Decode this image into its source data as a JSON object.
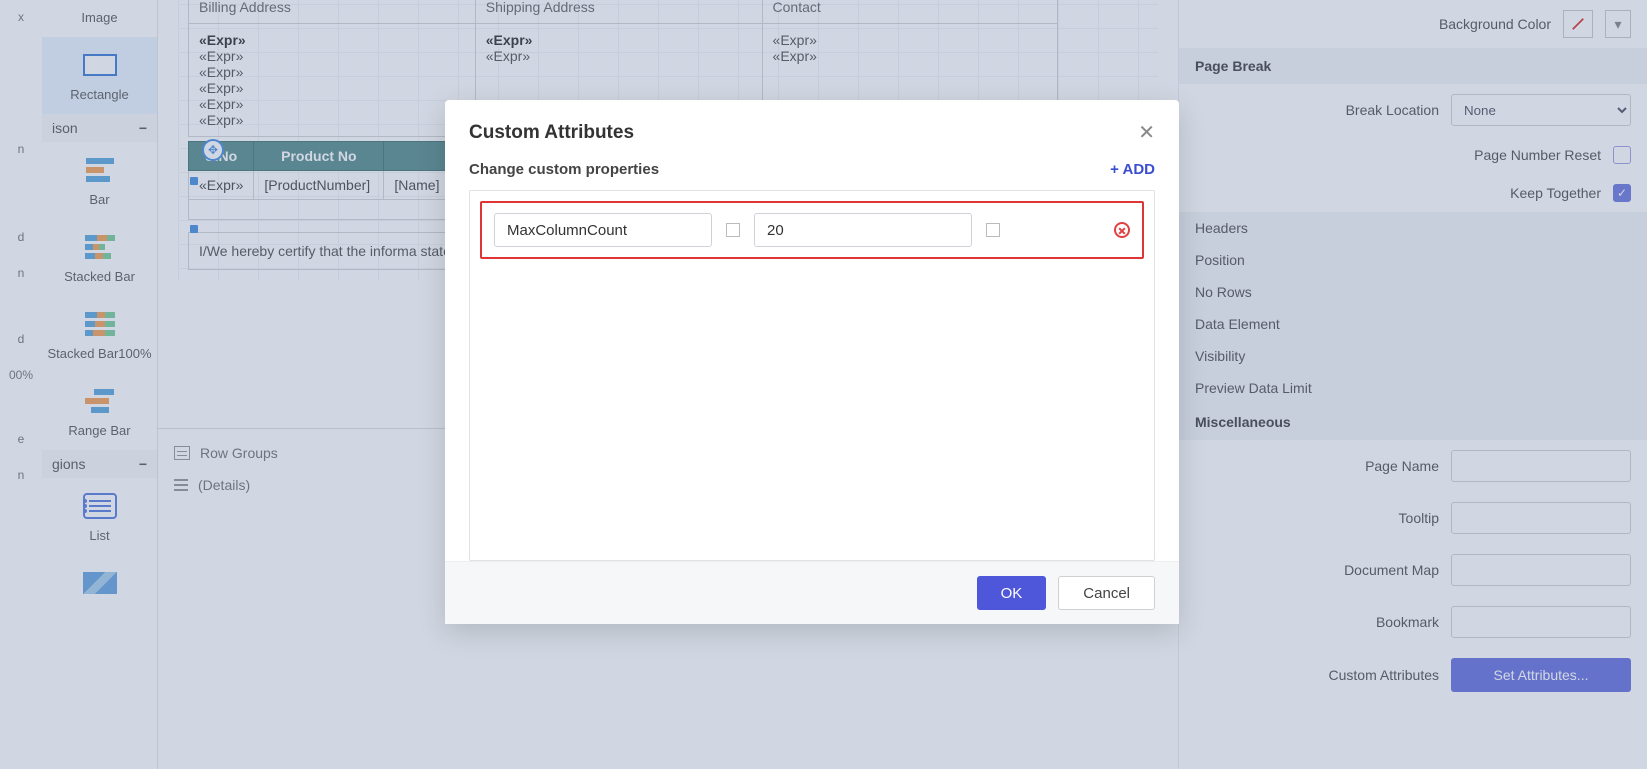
{
  "toolbox": {
    "items_top": [
      {
        "label": "Image"
      },
      {
        "label": "Rectangle",
        "selected": true
      }
    ],
    "section_comparison": "ison",
    "items_bar": [
      {
        "label": "Bar"
      },
      {
        "label": "Stacked Bar"
      },
      {
        "label": "Stacked Bar100%"
      },
      {
        "label": "Range Bar"
      }
    ],
    "section_regions": "gions",
    "items_region": [
      {
        "label": "List"
      }
    ],
    "narrow": [
      {
        "label": "x"
      },
      {
        "label": "n"
      },
      {
        "label": "d"
      },
      {
        "label": "n"
      },
      {
        "label": "d"
      },
      {
        "label": "00%"
      },
      {
        "label": "e"
      },
      {
        "label": "n"
      }
    ]
  },
  "report": {
    "headers": {
      "billing": "Billing Address",
      "shipping": "Shipping Address",
      "contact": "Contact"
    },
    "billing_rows": [
      "«Expr»",
      "«Expr»",
      "«Expr»",
      "«Expr»",
      "«Expr»",
      "«Expr»"
    ],
    "shipping_rows": [
      "«Expr»",
      "«Expr»"
    ],
    "contact_rows": [
      "«Expr»",
      "«Expr»"
    ],
    "product_headers": [
      "S.No",
      "Product No"
    ],
    "product_cells": [
      "«Expr»",
      "[ProductNumber]",
      "[Name]"
    ],
    "cert_text": "I/We hereby certify that the informa                                                                  stated above.",
    "row_groups_label": "Row Groups",
    "details_label": "(Details)"
  },
  "properties": {
    "background_color_label": "Background Color",
    "page_break_section": "Page Break",
    "break_location_label": "Break Location",
    "break_location_value": "None",
    "page_number_reset_label": "Page Number Reset",
    "keep_together_label": "Keep Together",
    "sections": [
      "Headers",
      "Position",
      "No Rows",
      "Data Element",
      "Visibility",
      "Preview Data Limit",
      "Miscellaneous"
    ],
    "page_name_label": "Page Name",
    "tooltip_label": "Tooltip",
    "document_map_label": "Document Map",
    "bookmark_label": "Bookmark",
    "custom_attributes_label": "Custom Attributes",
    "set_attributes_button": "Set Attributes..."
  },
  "modal": {
    "title": "Custom Attributes",
    "subtitle": "Change custom properties",
    "add_label": "+ ADD",
    "attr_name": "MaxColumnCount",
    "attr_value": "20",
    "ok_label": "OK",
    "cancel_label": "Cancel"
  }
}
